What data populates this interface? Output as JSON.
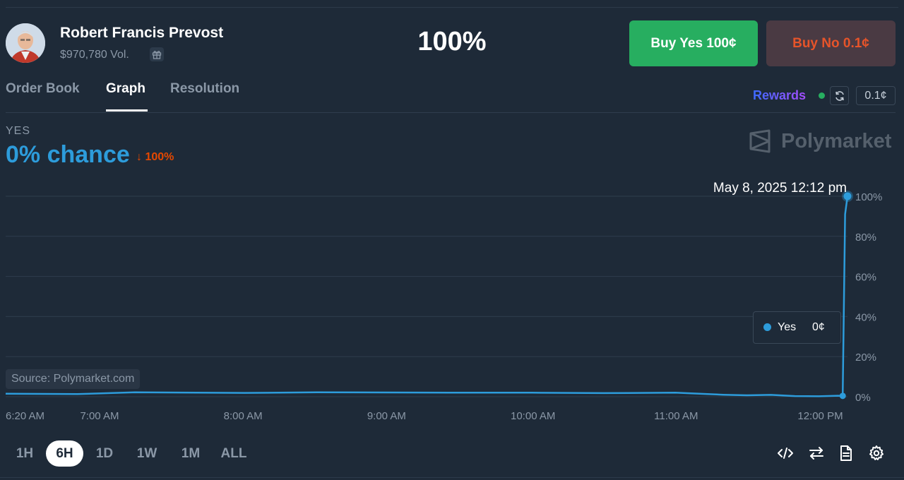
{
  "market": {
    "title": "Robert Francis Prevost",
    "volume": "$970,780 Vol.",
    "big_percent": "100%"
  },
  "buttons": {
    "buy_yes": "Buy Yes 100¢",
    "buy_no": "Buy No 0.1¢"
  },
  "tabs": [
    "Order Book",
    "Graph",
    "Resolution"
  ],
  "active_tab": "Graph",
  "rewards": {
    "label": "Rewards",
    "value": "0.1¢"
  },
  "outcome": {
    "label": "YES",
    "chance": "0% chance",
    "change": "↓ 100%"
  },
  "brand": "Polymarket",
  "source_label": "Source: Polymarket.com",
  "tooltip": {
    "series": "Yes",
    "value": "0¢"
  },
  "time_ranges": [
    "1H",
    "6H",
    "1D",
    "1W",
    "1M",
    "ALL"
  ],
  "active_range": "6H",
  "colors": {
    "background": "#1e2a38",
    "line": "#2d9cdb",
    "buy_yes": "#27ae60",
    "buy_no_text": "#e6542a",
    "change_down": "#e64800"
  },
  "icons": [
    "gift-icon",
    "refresh-icon",
    "embed-code-icon",
    "swap-icon",
    "document-icon",
    "settings-gear-icon"
  ],
  "chart_data": {
    "type": "line",
    "title": "",
    "xlabel": "",
    "ylabel": "",
    "x_ticks": [
      "6:20 AM",
      "7:00 AM",
      "8:00 AM",
      "9:00 AM",
      "10:00 AM",
      "11:00 AM",
      "12:00 PM"
    ],
    "y_ticks": [
      "0%",
      "20%",
      "40%",
      "60%",
      "80%",
      "100%"
    ],
    "ylim": [
      0,
      100
    ],
    "xlim": [
      "6:20 AM",
      "12:12 PM"
    ],
    "grid": true,
    "hover_label": "May 8, 2025 12:12 pm",
    "series": [
      {
        "name": "Yes",
        "x": [
          "6:20 AM",
          "6:50 AM",
          "7:14 AM",
          "7:40 AM",
          "8:00 AM",
          "8:30 AM",
          "9:00 AM",
          "9:30 AM",
          "10:00 AM",
          "10:30 AM",
          "11:00 AM",
          "11:10 AM",
          "11:20 AM",
          "11:30 AM",
          "11:40 AM",
          "11:50 AM",
          "12:00 PM",
          "12:08 PM",
          "12:10 PM",
          "12:11 PM",
          "12:12 PM"
        ],
        "values": [
          1.5,
          1.3,
          2.2,
          2.0,
          1.9,
          2.2,
          2.1,
          2.0,
          2.0,
          1.8,
          2.0,
          1.5,
          1.0,
          0.7,
          0.9,
          0.3,
          0.2,
          0.5,
          0.4,
          91,
          100
        ]
      }
    ]
  }
}
